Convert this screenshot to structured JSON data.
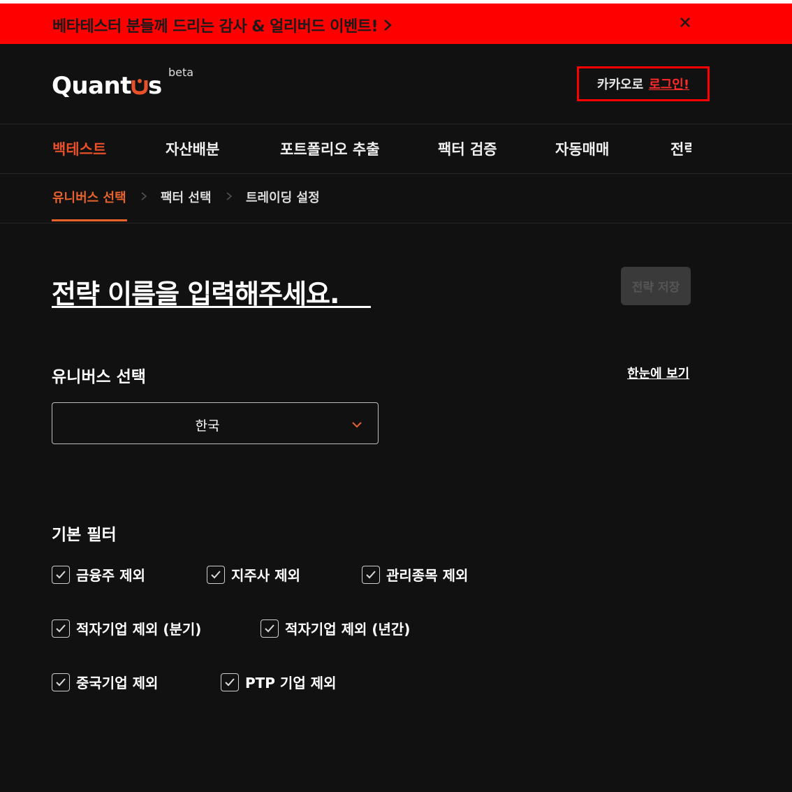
{
  "banner": {
    "text": "베타테스터 분들께 드리는 감사 & 얼리버드 이벤트!",
    "arrow": "chevron-right-icon",
    "close_icon": "close-icon",
    "bg_color": "#ff0000"
  },
  "header": {
    "logo_text": "Quantus",
    "logo_beta": "beta",
    "login_prefix": "카카오로",
    "login_link": "로그인!"
  },
  "nav": {
    "items": [
      {
        "label": "백테스트",
        "active": true
      },
      {
        "label": "자산배분",
        "active": false
      },
      {
        "label": "포트폴리오 추출",
        "active": false
      },
      {
        "label": "팩터 검증",
        "active": false
      },
      {
        "label": "자동매매",
        "active": false
      },
      {
        "label": "전략",
        "active": false
      }
    ],
    "accent_color": "#e8502a"
  },
  "steps": {
    "items": [
      {
        "label": "유니버스 선택",
        "active": true
      },
      {
        "label": "팩터 선택",
        "active": false
      },
      {
        "label": "트레이딩 설정",
        "active": false
      }
    ]
  },
  "strategy": {
    "title_placeholder": "전략 이름을 입력해주세요.",
    "save_button": "전략 저장"
  },
  "universe": {
    "section_title": "유니버스 선택",
    "overview_link": "한눈에 보기",
    "selected": "한국"
  },
  "filters": {
    "section_title": "기본 필터",
    "items": [
      {
        "label": "금융주 제외",
        "checked": true
      },
      {
        "label": "지주사 제외",
        "checked": true
      },
      {
        "label": "관리종목 제외",
        "checked": true
      },
      {
        "label": "적자기업 제외 (분기)",
        "checked": true
      },
      {
        "label": "적자기업 제외 (년간)",
        "checked": true
      },
      {
        "label": "중국기업 제외",
        "checked": true
      },
      {
        "label": "PTP 기업 제외",
        "checked": true
      }
    ]
  }
}
